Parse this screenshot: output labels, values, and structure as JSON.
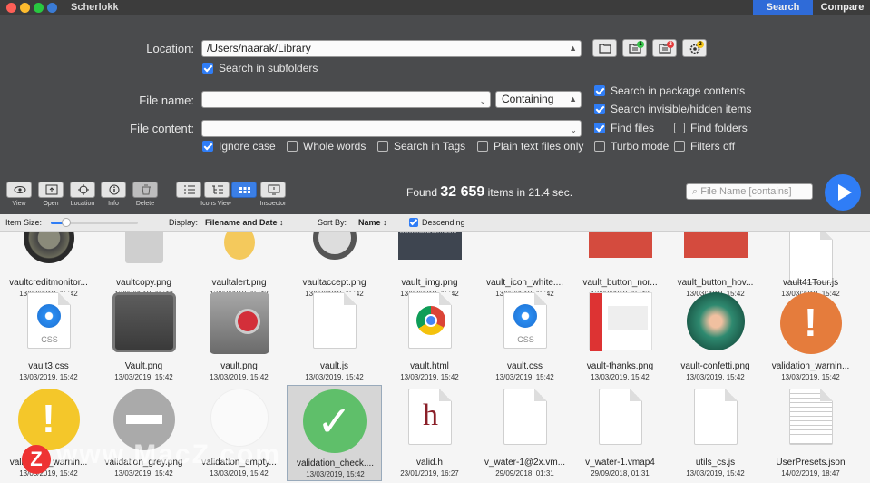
{
  "app_title": "Scherlokk",
  "modes": {
    "search": "Search",
    "compare": "Compare"
  },
  "form": {
    "location_label": "Location:",
    "location_value": "/Users/naarak/Library",
    "search_subfolders": "Search in subfolders",
    "file_name_label": "File name:",
    "match_mode": "Containing",
    "file_content_label": "File content:",
    "options_left": [
      {
        "label": "Ignore case",
        "checked": true
      },
      {
        "label": "Whole words",
        "checked": false
      },
      {
        "label": "Search in Tags",
        "checked": false
      },
      {
        "label": "Plain text files only",
        "checked": false
      }
    ],
    "options_right": [
      {
        "label": "Search in package contents",
        "checked": true
      },
      {
        "label": "Search invisible/hidden items",
        "checked": true
      },
      {
        "label": "Find files",
        "checked": true
      },
      {
        "label": "Find folders",
        "checked": false
      },
      {
        "label": "Turbo mode",
        "checked": false
      },
      {
        "label": "Filters off",
        "checked": false
      }
    ],
    "badges": [
      "1",
      "2",
      "2"
    ]
  },
  "toolbar": {
    "view": "View",
    "open": "Open",
    "location": "Location",
    "info": "Info",
    "delete": "Delete",
    "icons_view": "Icons View",
    "inspector": "Inspector",
    "found_prefix": "Found",
    "found_count": "32 659",
    "found_suffix": "items in 21.4 sec.",
    "filter_placeholder": "File Name [contains]"
  },
  "optbar": {
    "item_size_label": "Item Size:",
    "item_size_level": 0.18,
    "display_label": "Display:",
    "display_value": "Filename and Date",
    "sort_label": "Sort By:",
    "sort_value": "Name",
    "descending": "Descending"
  },
  "rows": [
    [
      {
        "name": "vaultcreditmonitor...",
        "date": "13/03/2019, 15:42",
        "icon": "gauge"
      },
      {
        "name": "vaultcopy.png",
        "date": "13/03/2019, 15:42",
        "icon": "gray-box"
      },
      {
        "name": "vaultalert.png",
        "date": "13/03/2019, 15:42",
        "icon": "bulb"
      },
      {
        "name": "vaultaccept.png",
        "date": "13/03/2019, 15:42",
        "icon": "check-dark"
      },
      {
        "name": "vault_img.png",
        "date": "13/03/2019, 15:42",
        "icon": "screenshot"
      },
      {
        "name": "vault_icon_white....",
        "date": "13/03/2019, 15:42",
        "icon": "blank"
      },
      {
        "name": "vault_button_nor...",
        "date": "13/03/2019, 15:42",
        "icon": "red-rect"
      },
      {
        "name": "vault_button_hov...",
        "date": "13/03/2019, 15:42",
        "icon": "red-rect"
      },
      {
        "name": "vault41Tour.js",
        "date": "13/03/2019, 15:42",
        "icon": "doc"
      }
    ],
    [
      {
        "name": "vault3.css",
        "date": "13/03/2019, 15:42",
        "icon": "css"
      },
      {
        "name": "Vault.png",
        "date": "13/03/2019, 15:42",
        "icon": "safe-dark"
      },
      {
        "name": "vault.png",
        "date": "13/03/2019, 15:42",
        "icon": "safe"
      },
      {
        "name": "vault.js",
        "date": "13/03/2019, 15:42",
        "icon": "doc"
      },
      {
        "name": "vault.html",
        "date": "13/03/2019, 15:42",
        "icon": "chrome"
      },
      {
        "name": "vault.css",
        "date": "13/03/2019, 15:42",
        "icon": "css"
      },
      {
        "name": "vault-thanks.png",
        "date": "13/03/2019, 15:42",
        "icon": "webpage"
      },
      {
        "name": "vault-confetti.png",
        "date": "13/03/2019, 15:42",
        "icon": "confetti"
      },
      {
        "name": "validation_warnin...",
        "date": "13/03/2019, 15:42",
        "icon": "warn-orange"
      }
    ],
    [
      {
        "name": "validation_warnin...",
        "date": "13/03/2019, 15:42",
        "icon": "warn-yellow"
      },
      {
        "name": "validation_grey.png",
        "date": "13/03/2019, 15:42",
        "icon": "minus-grey"
      },
      {
        "name": "validation_empty...",
        "date": "13/03/2019, 15:42",
        "icon": "empty"
      },
      {
        "name": "validation_check....",
        "date": "13/03/2019, 15:42",
        "icon": "check-green",
        "selected": true
      },
      {
        "name": "valid.h",
        "date": "23/01/2019, 16:27",
        "icon": "h-file"
      },
      {
        "name": "v_water-1@2x.vm...",
        "date": "29/09/2018, 01:31",
        "icon": "doc"
      },
      {
        "name": "v_water-1.vmap4",
        "date": "29/09/2018, 01:31",
        "icon": "doc"
      },
      {
        "name": "utils_cs.js",
        "date": "13/03/2019, 15:42",
        "icon": "doc"
      },
      {
        "name": "UserPresets.json",
        "date": "14/02/2019, 18:47",
        "icon": "text-doc"
      }
    ]
  ],
  "watermark": "www.MacZ.com",
  "watermark_logo": "Z",
  "thumb_caption": "www.MacDown.com",
  "colors": {
    "accent": "#2f7df6",
    "panel": "#4a4b4d",
    "titlebar": "#3c3c3c"
  }
}
